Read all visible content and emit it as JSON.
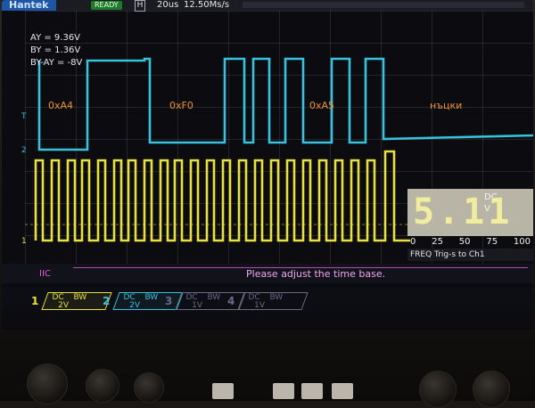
{
  "header": {
    "brand": "Hantek",
    "status": "READY",
    "mode_indicator": "H",
    "time_base": "20us",
    "sample_rate": "12.50Ms/s"
  },
  "cursors": {
    "ay": "AY    = 9.36V",
    "by": "BY    = 1.36V",
    "delta": "BY-AY = -8V"
  },
  "decode_labels": [
    "0xA4",
    "0xF0",
    "0xA5",
    "нъцки"
  ],
  "meter": {
    "value": "5.11",
    "coupling": "DC",
    "unit": "V",
    "scale": [
      "0",
      "25",
      "50",
      "75",
      "100"
    ],
    "footer": "FREQ  Trig-s to Ch1"
  },
  "bus": {
    "label": "IIC",
    "message": "Please adjust the time base."
  },
  "channels": [
    {
      "number": "1",
      "coupling": "DC",
      "bw": "BW",
      "vdiv": "2V",
      "color": "#e8e23a"
    },
    {
      "number": "2",
      "coupling": "DC",
      "bw": "BW",
      "vdiv": "2V",
      "color": "#37c3dd"
    },
    {
      "number": "3",
      "coupling": "DC",
      "bw": "BW",
      "vdiv": "1V",
      "color": "#6a6a86"
    },
    {
      "number": "4",
      "coupling": "DC",
      "bw": "BW",
      "vdiv": "1V",
      "color": "#6a6a86"
    }
  ],
  "markers": {
    "ch2": "2",
    "trigger": "T",
    "ch1": "1"
  },
  "colors": {
    "ch1": "#e8e23a",
    "ch2": "#37c3dd",
    "decode_label": "#f0922e",
    "bus": "#e35bdc"
  }
}
